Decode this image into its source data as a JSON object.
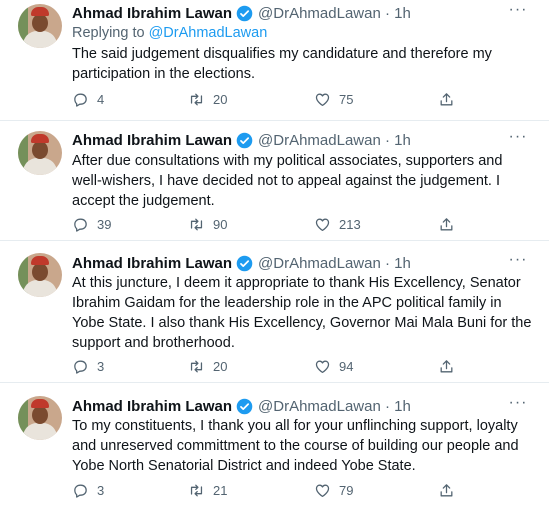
{
  "tweets": [
    {
      "name": "Ahmad Ibrahim Lawan",
      "handle": "@DrAhmadLawan · 1h",
      "replying_prefix": "Replying to ",
      "replying_handle": "@DrAhmadLawan",
      "text": "The said judgement disqualifies my candidature and therefore my participation in the elections.",
      "replies": "4",
      "retweets": "20",
      "likes": "75"
    },
    {
      "name": "Ahmad Ibrahim Lawan",
      "handle": "@DrAhmadLawan · 1h",
      "text": "After due consultations with my political associates, supporters and well-wishers, I have decided not to appeal against the judgement. I accept the judgement.",
      "replies": "39",
      "retweets": "90",
      "likes": "213"
    },
    {
      "name": "Ahmad Ibrahim Lawan",
      "handle": "@DrAhmadLawan · 1h",
      "text": "At this juncture, I deem it appropriate to thank His Excellency, Senator Ibrahim Gaidam for the leadership role in the APC political family in Yobe State. I also thank His Excellency, Governor Mai Mala Buni for the support and brotherhood.",
      "replies": "3",
      "retweets": "20",
      "likes": "94"
    },
    {
      "name": "Ahmad Ibrahim Lawan",
      "handle": "@DrAhmadLawan · 1h",
      "text": "To my constituents, I thank you all for your unflinching support, loyalty and unreserved committment to the course of building our people and Yobe North Senatorial District and indeed Yobe State.",
      "replies": "3",
      "retweets": "21",
      "likes": "79"
    }
  ],
  "icons": {
    "verified": "verified-badge-icon",
    "more": "more-options-icon",
    "reply": "reply-icon",
    "retweet": "retweet-icon",
    "like": "heart-icon",
    "share": "share-icon"
  },
  "colors": {
    "accent": "#1d9bf0",
    "secondary_text": "#536471",
    "divider": "#e6ecf0"
  }
}
